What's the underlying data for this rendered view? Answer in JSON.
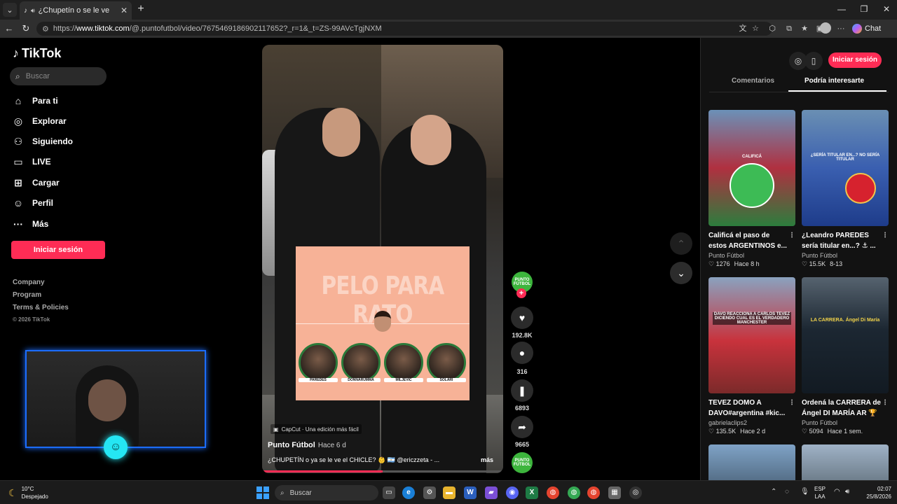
{
  "browser": {
    "tab_title": "¿Chupetín o se le ve el chicle",
    "tab_close": "✕",
    "new_tab": "+",
    "url_prefix": "https://",
    "url_domain": "www.tiktok.com",
    "url_path": "/@.puntofutbol/video/7675469186902117652?_r=1&_t=ZS-99AVcTgjNXM",
    "chat_label": "Chat"
  },
  "sidebar": {
    "brand": "TikTok",
    "search_placeholder": "Buscar",
    "items": [
      {
        "label": "Para ti",
        "icon": "home-icon"
      },
      {
        "label": "Explorar",
        "icon": "compass-icon"
      },
      {
        "label": "Siguiendo",
        "icon": "following-icon"
      },
      {
        "label": "LIVE",
        "icon": "live-icon"
      },
      {
        "label": "Cargar",
        "icon": "upload-icon"
      },
      {
        "label": "Perfil",
        "icon": "profile-icon"
      },
      {
        "label": "Más",
        "icon": "more-icon"
      }
    ],
    "login_button": "Iniciar sesión",
    "footer_links": [
      "Company",
      "Program",
      "Terms & Policies"
    ],
    "copyright": "© 2026 TikTok"
  },
  "video": {
    "overlay_title": "PELO PARA RATO",
    "players": [
      "PAREDES",
      "DONNARUMMA",
      "MILJEVIC",
      "SOLARI"
    ],
    "capcut_label": "CapCut · Una edición más fácil",
    "author": "Punto Fútbol",
    "age": "Hace 6 d",
    "description": "¿CHUPETÍN o ya se le ve el CHICLE? 👶 🇦🇷 @ericzzeta - ...",
    "more": "más",
    "progress": 0.5
  },
  "actions": {
    "avatar_text": "PUNTO FÚTBOL",
    "likes": "192.8K",
    "comments": "316",
    "saves": "6893",
    "shares": "9665"
  },
  "right_panel": {
    "login_button": "Iniciar sesión",
    "tab_comments": "Comentarios",
    "tab_interest": "Podría interesarte",
    "cards": [
      {
        "title": "Calificá el paso de estos ARGENTINOS e...",
        "author": "Punto Fútbol",
        "likes": "1276",
        "time": "Hace 8 h",
        "thumb_text": "CALIFICÁ"
      },
      {
        "title": "¿Leandro PAREDES sería titular en...? ⚓ ...",
        "author": "Punto Fútbol",
        "likes": "15.5K",
        "time": "8-13",
        "thumb_text": "¿SERÍA TITULAR EN...? NO SERÍA TITULAR"
      },
      {
        "title": "TEVEZ DOMO A DAVO#argentina #kic...",
        "author": "gabrielaclips2",
        "likes": "135.5K",
        "time": "Hace 2 d",
        "thumb_text": "DAVO REACCIONA A CARLOS TEVEZ DICIENDO CUAL ES EL VERDADERO MANCHESTER"
      },
      {
        "title": "Ordená la CARRERA de Ángel DI MARÍA AR 🏆 ...",
        "author": "Punto Fútbol",
        "likes": "5094",
        "time": "Hace 1 sem.",
        "thumb_text": "LA CARRERA. Ángel Di María"
      }
    ]
  },
  "taskbar": {
    "temp": "10°C",
    "weather": "Despejado",
    "search_placeholder": "Buscar",
    "lang1": "ESP",
    "lang2": "LAA",
    "time": "02:07",
    "date": "25/8/2026"
  }
}
